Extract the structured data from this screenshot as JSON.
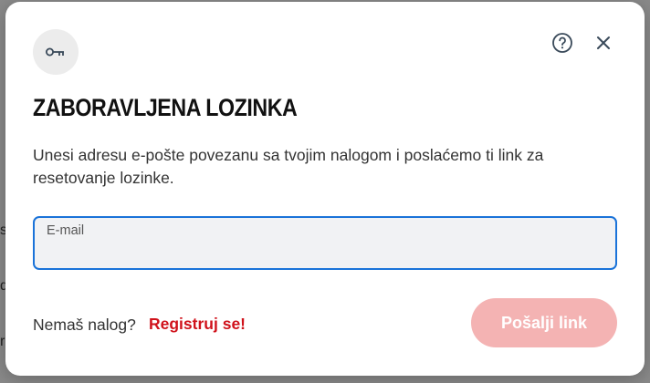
{
  "backdrop": {
    "fragments": [
      "so",
      "d",
      "r"
    ]
  },
  "modal": {
    "icons": {
      "badge": "key-icon",
      "help": "help-circle-icon",
      "close": "close-icon"
    },
    "title": "ZABORAVLJENA LOZINKA",
    "description": "Unesi adresu e-pošte povezanu sa tvojim nalogom i poslaćemo ti link za resetovanje lozinke.",
    "email": {
      "label": "E-mail",
      "value": ""
    },
    "footer": {
      "no_account_text": "Nemaš nalog?",
      "register_link": "Registruj se!",
      "submit_label": "Pošalji link"
    },
    "colors": {
      "accent_red": "#d0121b",
      "submit_disabled_bg": "#f4b3b3",
      "focus_border": "#1a73d9"
    }
  }
}
